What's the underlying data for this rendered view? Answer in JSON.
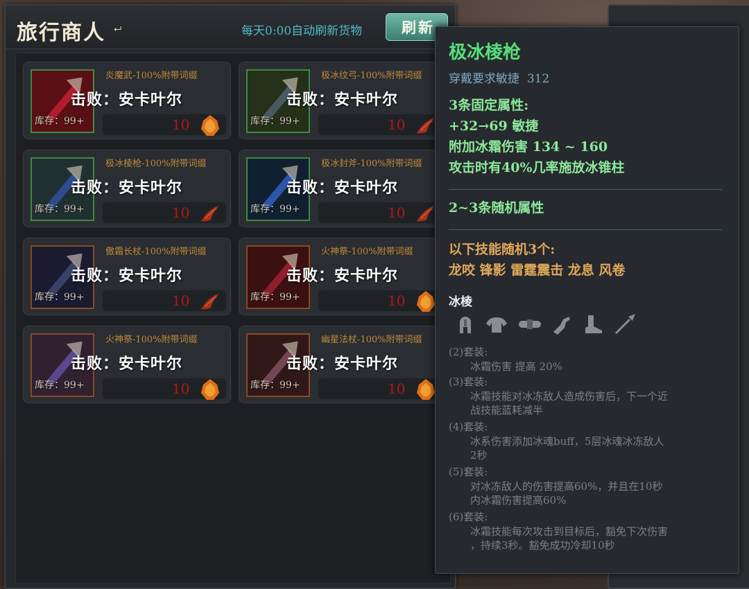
{
  "shop": {
    "title": "旅行商人",
    "refresh_note": "每天0:00自动刷新货物",
    "refresh_button": "刷新"
  },
  "items": [
    {
      "name": "炎魔武-100%附带词缀",
      "defeat": "击败：安卡叶尔",
      "stock": "库存：99+",
      "price": "10",
      "frame": "green",
      "currency": "ore"
    },
    {
      "name": "极冰纹弓-100%附带词缀",
      "defeat": "击败：安卡叶尔",
      "stock": "库存：99+",
      "price": "10",
      "frame": "green",
      "currency": "claw"
    },
    {
      "name": "极冰棱枪-100%附带词缀",
      "defeat": "击败：安卡叶尔",
      "stock": "库存：99+",
      "price": "10",
      "frame": "green",
      "currency": "claw"
    },
    {
      "name": "极冰封斧-100%附带词缀",
      "defeat": "击败：安卡叶尔",
      "stock": "库存：99+",
      "price": "10",
      "frame": "green",
      "currency": "claw"
    },
    {
      "name": "傲霜长杖-100%附带词缀",
      "defeat": "击败：安卡叶尔",
      "stock": "库存：99+",
      "price": "10",
      "frame": "orange",
      "currency": "claw"
    },
    {
      "name": "火神祭-100%附带词缀",
      "defeat": "击败：安卡叶尔",
      "stock": "库存：99+",
      "price": "10",
      "frame": "orange",
      "currency": "ore"
    },
    {
      "name": "火神祭-100%附带词缀",
      "defeat": "击败：安卡叶尔",
      "stock": "库存：99+",
      "price": "10",
      "frame": "orange",
      "currency": "ore"
    },
    {
      "name": "幽星法杖-100%附带词缀",
      "defeat": "击败：安卡叶尔",
      "stock": "库存：99+",
      "price": "10",
      "frame": "orange",
      "currency": "ore"
    }
  ],
  "tooltip": {
    "name": "极冰棱枪",
    "requirement_label": "穿戴要求敏捷",
    "requirement_value": "312",
    "fixed_header": "3条固定属性:",
    "fixed_attrs": [
      "+32→69  敏捷",
      "附加冰霜伤害  134  ~  160",
      "攻击时有40%几率施放冰锥柱"
    ],
    "random_header": "2~3条随机属性",
    "skill_header": "以下技能随机3个:",
    "skills": "龙咬  锋影  雷霆震击  龙息  风卷",
    "set_name": "冰棱",
    "set_icons": [
      "helmet-icon",
      "shoulder-armor-icon",
      "belt-icon",
      "gauntlet-icon",
      "boots-icon",
      "spear-icon"
    ],
    "set_bonuses": [
      {
        "head": "(2)套装:",
        "lines": [
          "冰霜伤害  提高  20%"
        ]
      },
      {
        "head": "(3)套装:",
        "lines": [
          "冰霜技能对冰冻敌人造成伤害后，下一个近",
          "战技能蓝耗减半"
        ]
      },
      {
        "head": "(4)套装:",
        "lines": [
          "冰系伤害添加冰魂buff，5层冰魂冰冻敌人",
          "2秒"
        ]
      },
      {
        "head": "(5)套装:",
        "lines": [
          "对冰冻敌人的伤害提高60%，并且在10秒",
          "内冰霜伤害提高60%"
        ]
      },
      {
        "head": "(6)套装:",
        "lines": [
          "冰霜技能每次攻击到目标后，豁免下次伤害",
          "，持续3秒。豁免成功冷却10秒"
        ]
      }
    ],
    "colors": {
      "name": "#57e07a",
      "attr": "#8ce99a",
      "skill": "#e0a85a",
      "set": "#7d8085"
    }
  }
}
